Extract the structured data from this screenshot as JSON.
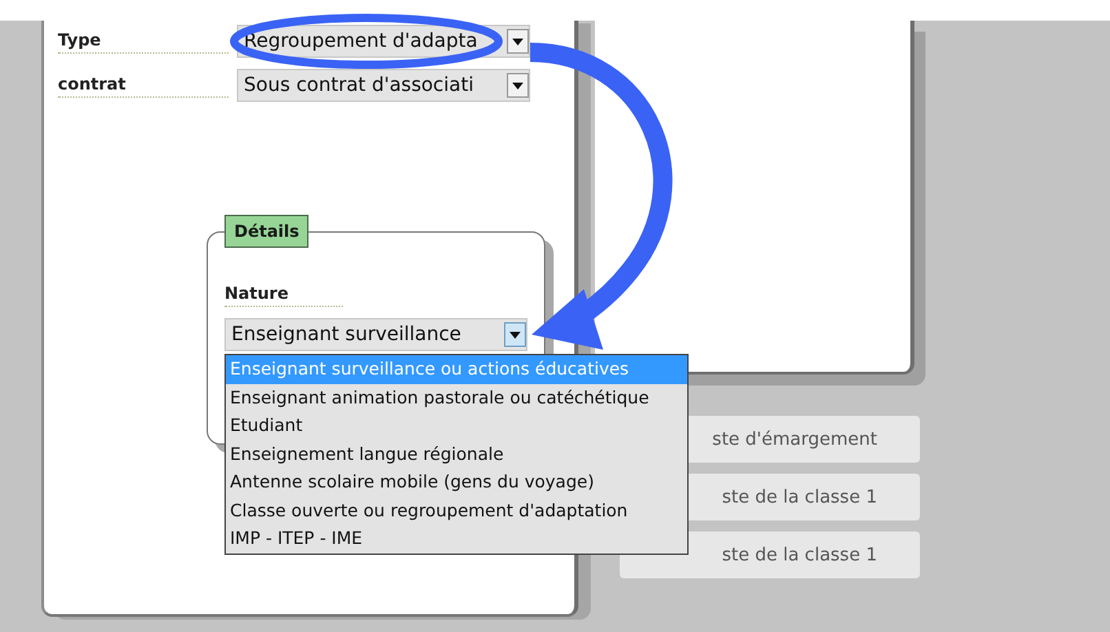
{
  "fields": [
    {
      "label": "Type",
      "value": "Regroupement d'adapta"
    },
    {
      "label": "contrat",
      "value": "Sous contrat d'associati"
    }
  ],
  "details": {
    "legend": "Détails",
    "nature": {
      "label": "Nature",
      "value": "Enseignant surveillance",
      "options": [
        {
          "label": "Enseignant surveillance ou actions éducatives",
          "selected": true
        },
        {
          "label": "Enseignant animation pastorale ou catéchétique",
          "selected": false
        },
        {
          "label": "Etudiant",
          "selected": false
        },
        {
          "label": "Enseignement langue régionale",
          "selected": false
        },
        {
          "label": "Antenne scolaire mobile (gens du voyage)",
          "selected": false
        },
        {
          "label": "Classe ouverte ou regroupement d'adaptation",
          "selected": false
        },
        {
          "label": "IMP - ITEP - IME",
          "selected": false
        }
      ]
    }
  },
  "buttons": [
    "ste d'émargement",
    "ste de la classe 1",
    "ste de la classe 1"
  ]
}
